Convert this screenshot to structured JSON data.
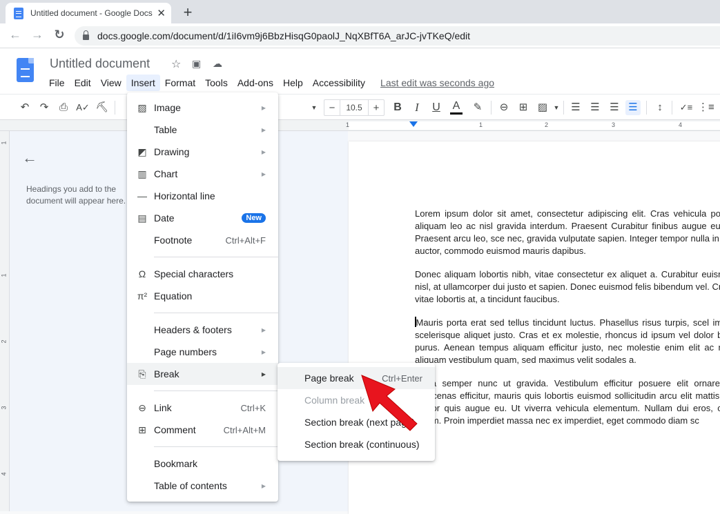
{
  "browser": {
    "tab_title": "Untitled document - Google Docs",
    "tab_close": "✕",
    "new_tab": "+",
    "back": "←",
    "forward": "→",
    "reload": "↻",
    "url": "docs.google.com/document/d/1iI6vm9j6BbzHisqG0paolJ_NqXBfT6A_arJC-jvTKeQ/edit"
  },
  "doc": {
    "title": "Untitled document",
    "menu": [
      "File",
      "Edit",
      "View",
      "Insert",
      "Format",
      "Tools",
      "Add-ons",
      "Help",
      "Accessibility"
    ],
    "active_menu": "Insert",
    "last_edit": "Last edit was seconds ago"
  },
  "toolbar": {
    "font_size": "10.5",
    "decrease": "−",
    "increase": "+"
  },
  "ruler": {
    "ticks": [
      "1",
      "1",
      "2",
      "3",
      "4"
    ],
    "vticks": [
      "1",
      "1",
      "2",
      "3",
      "4"
    ]
  },
  "outline": {
    "hint": "Headings you add to the document will appear here."
  },
  "insert_menu": {
    "items": [
      {
        "label": "Image",
        "icon": "image-icon",
        "submenu": true
      },
      {
        "label": "Table",
        "icon": "",
        "submenu": true
      },
      {
        "label": "Drawing",
        "icon": "drawing-icon",
        "submenu": true
      },
      {
        "label": "Chart",
        "icon": "chart-icon",
        "submenu": true
      },
      {
        "label": "Horizontal line",
        "icon": "horizontal-line-icon"
      },
      {
        "label": "Date",
        "icon": "calendar-icon",
        "badge": "New"
      },
      {
        "label": "Footnote",
        "shortcut": "Ctrl+Alt+F"
      },
      {
        "label": "Special characters",
        "icon": "omega-icon"
      },
      {
        "label": "Equation",
        "icon": "pi-icon"
      },
      {
        "label": "Headers & footers",
        "submenu": true
      },
      {
        "label": "Page numbers",
        "submenu": true
      },
      {
        "label": "Break",
        "icon": "break-icon",
        "submenu": true,
        "highlighted": true
      },
      {
        "label": "Link",
        "icon": "link-icon",
        "shortcut": "Ctrl+K"
      },
      {
        "label": "Comment",
        "icon": "comment-icon",
        "shortcut": "Ctrl+Alt+M"
      },
      {
        "label": "Bookmark"
      },
      {
        "label": "Table of contents",
        "submenu": true
      }
    ]
  },
  "break_menu": {
    "items": [
      {
        "label": "Page break",
        "shortcut": "Ctrl+Enter",
        "highlighted": true
      },
      {
        "label": "Column break",
        "disabled": true
      },
      {
        "label": "Section break (next page)"
      },
      {
        "label": "Section break (continuous)"
      }
    ]
  },
  "document_text": {
    "paragraphs": [
      "Lorem ipsum dolor sit amet, consectetur adipiscing elit. Cras vehicula porttitor non. Vivamus aliquam leo ac nisl gravida interdum. Praesent Curabitur finibus augue eu ex finibus aliquam. Praesent arcu leo, sce nec, gravida vulputate sapien. Integer tempor nulla in tristique varius nulla auctor, commodo euismod mauris dapibus.",
      "Donec aliquam lobortis nibh, vitae consectetur ex aliquet a. Curabitur euismod, orci nisl iaculis nisl, at ullamcorper dui justo et sapien. Donec euismod felis bibendum vel. Cras enim elit, gravida vitae lobortis at, a tincidunt faucibus.",
      "Mauris porta erat sed tellus tincidunt luctus. Phasellus risus turpis, scel imperdiet lacus. Proin scelerisque aliquet justo. Cras et ex molestie, rhoncus id ipsum vel dolor blandit mollis a vitae purus. Aenean tempus aliquam efficitur justo, nec molestie enim elit ac nunc. Sed vulputate aliquam vestibulum quam, sed maximus velit sodales a.",
      "Porta semper nunc ut gravida. Vestibulum efficitur posuere elit ornare quis pellentesque. Maecenas efficitur, mauris quis lobortis euismod sollicitudin arcu elit mattis nisi. Ut felis metus, auctor quis augue eu. Ut viverra vehicula elementum. Nullam dui eros, consectetur sit amet ipsum. Proin imperdiet massa nec ex imperdiet, eget commodo diam sc"
    ]
  },
  "colors": {
    "accent": "#1a73e8",
    "arrow": "#e8141e"
  }
}
